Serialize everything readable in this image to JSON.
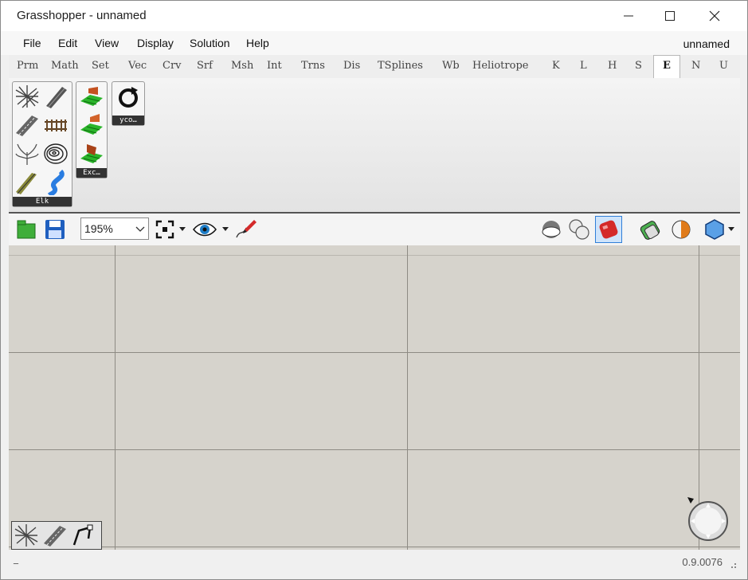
{
  "window": {
    "title": "Grasshopper - unnamed"
  },
  "menu": {
    "items": [
      "File",
      "Edit",
      "View",
      "Display",
      "Solution",
      "Help"
    ],
    "doc_name": "unnamed"
  },
  "tabs": [
    "Prm",
    "Math",
    "Set",
    "Vec",
    "Crv",
    "Srf",
    "Msh",
    "Int",
    "Trns",
    "Dis",
    "TSplines",
    "Wb",
    "Heliotrope",
    "K",
    "L",
    "H",
    "S",
    "E",
    "N",
    "U"
  ],
  "active_tab": "E",
  "ribbon": {
    "panels": [
      {
        "label": "Elk"
      },
      {
        "label": "Exc…"
      },
      {
        "label": "yco…"
      }
    ]
  },
  "toolbar": {
    "zoom": "195%"
  },
  "status": {
    "left_text": "_",
    "version": "0.9.0076"
  },
  "colors": {
    "canvas": "#d6d3cc",
    "grid": "#8e8b84",
    "accent_red": "#d42a2a"
  }
}
